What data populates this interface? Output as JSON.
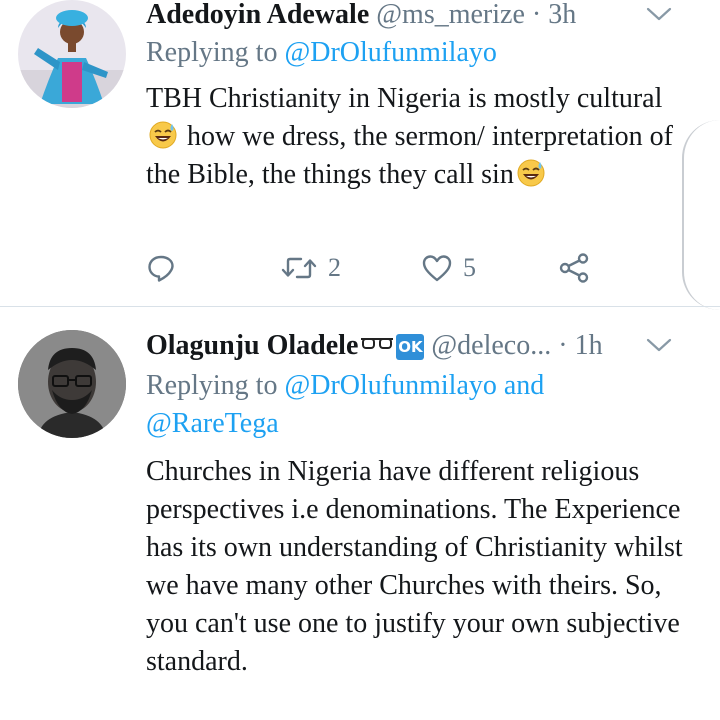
{
  "tweets": [
    {
      "author_name": "Adedoyin Adewale",
      "author_handle": "@ms_merize",
      "separator": "·",
      "time": "3h",
      "replying_prefix": "Replying to",
      "replying_to": "@DrOlufunmilayo",
      "body_parts": [
        "TBH Christianity in Nigeria is mostly cultural",
        "how we dress, the sermon/ interpretation of the Bible, the things they call sin"
      ],
      "actions": {
        "reply_icon": "reply-icon",
        "retweet_icon": "retweet-icon",
        "retweet_count": "2",
        "like_icon": "heart-icon",
        "like_count": "5",
        "share_icon": "share-icon"
      }
    },
    {
      "author_name": "Olagunju Oladele",
      "author_badge": "OK",
      "author_handle": "@deleco...",
      "separator": "·",
      "time": "1h",
      "replying_prefix": "Replying to",
      "replying_to": "@DrOlufunmilayo",
      "replying_and": "and",
      "replying_to_2": "@RareTega",
      "body": "Churches in Nigeria have different religious perspectives i.e denominations. The Experience has its own understanding of Christianity whilst we have many other Churches with theirs. So, you can't use one to justify your own subjective standard."
    }
  ],
  "colors": {
    "text": "#14171a",
    "muted": "#657786",
    "link": "#1da1f2",
    "divider": "#d9e1e8",
    "badge": "#2f8fd8"
  }
}
